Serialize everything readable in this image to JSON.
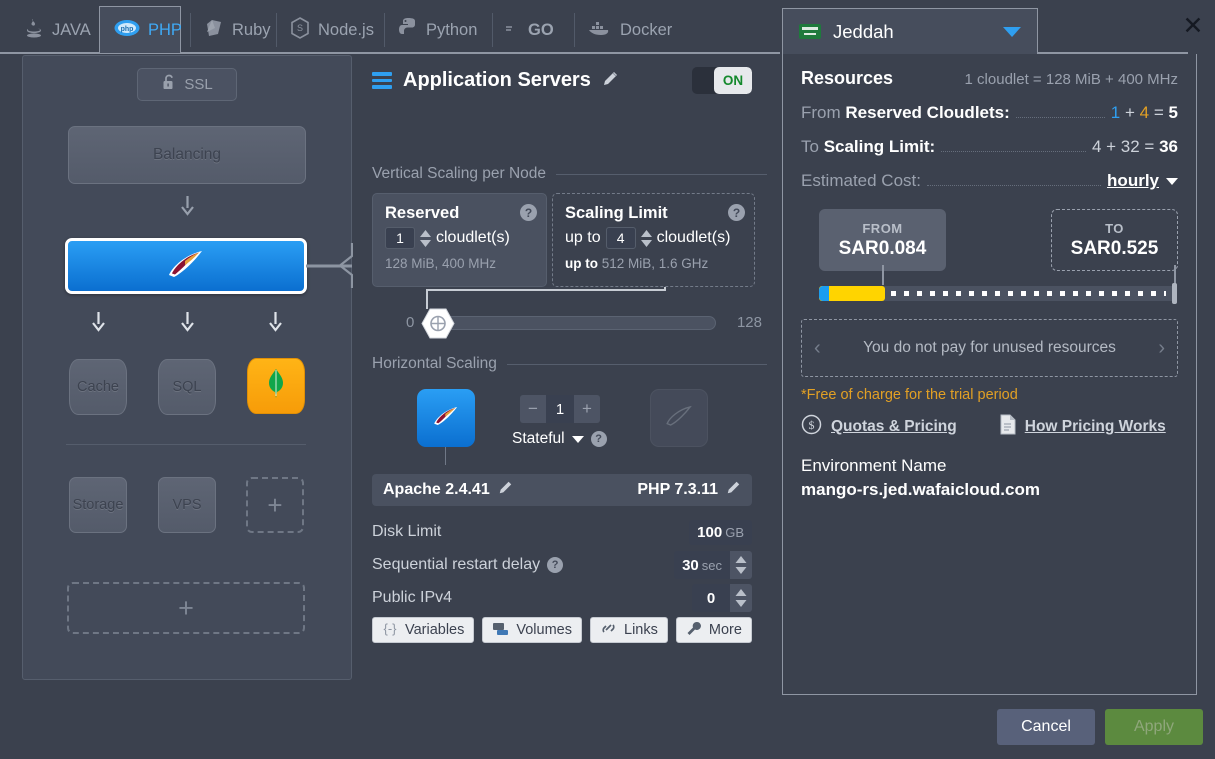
{
  "tabs": [
    {
      "id": "java",
      "label": "JAVA",
      "icon": "java-icon",
      "active": false
    },
    {
      "id": "php",
      "label": "PHP",
      "icon": "php-icon",
      "active": true
    },
    {
      "id": "ruby",
      "label": "Ruby",
      "icon": "ruby-icon",
      "active": false
    },
    {
      "id": "nodejs",
      "label": "Node.js",
      "icon": "nodejs-icon",
      "active": false
    },
    {
      "id": "python",
      "label": "Python",
      "icon": "python-icon",
      "active": false
    },
    {
      "id": "go",
      "label": "GO",
      "icon": "go-icon",
      "active": false
    },
    {
      "id": "docker",
      "label": "Docker",
      "icon": "docker-icon",
      "active": false
    }
  ],
  "topology": {
    "ssl_label": "SSL",
    "balancing_label": "Balancing",
    "selected_node_icon": "php-feather-icon",
    "tiles_row1": [
      {
        "label": "Cache",
        "kind": "text"
      },
      {
        "label": "SQL",
        "kind": "text"
      },
      {
        "label": "",
        "kind": "mongo"
      }
    ],
    "tiles_row2": [
      {
        "label": "Storage",
        "kind": "text"
      },
      {
        "label": "VPS",
        "kind": "text"
      },
      {
        "label": "+",
        "kind": "add"
      }
    ],
    "add_wide_label": "+"
  },
  "middle": {
    "title": "Application Servers",
    "toggle_label": "ON",
    "vertical_section": "Vertical Scaling per Node",
    "reserved": {
      "title": "Reserved",
      "value": "1",
      "unit": "cloudlet(s)",
      "sub": "128 MiB, 400 MHz",
      "help": "?"
    },
    "scaling_limit": {
      "title": "Scaling Limit",
      "prefix": "up to",
      "value": "4",
      "unit": "cloudlet(s)",
      "sub_prefix": "up to",
      "sub": "512 MiB, 1.6 GHz",
      "help": "?"
    },
    "slider": {
      "min": "0",
      "max": "128",
      "value": 1
    },
    "horizontal_section": "Horizontal Scaling",
    "node_count": "1",
    "minus": "−",
    "plus": "+",
    "stateful_label": "Stateful",
    "stateful_help": "?",
    "engine_left": "Apache 2.4.41",
    "engine_right": "PHP 7.3.11",
    "disk_limit": {
      "label": "Disk Limit",
      "value": "100",
      "unit": "GB"
    },
    "restart_delay": {
      "label": "Sequential restart delay",
      "help": "?",
      "value": "30",
      "unit": "sec"
    },
    "public_ipv4": {
      "label": "Public IPv4",
      "value": "0"
    },
    "buttons": [
      {
        "label": "Variables",
        "icon": "variables-icon"
      },
      {
        "label": "Volumes",
        "icon": "volumes-icon"
      },
      {
        "label": "Links",
        "icon": "links-icon"
      },
      {
        "label": "More",
        "icon": "wrench-icon"
      }
    ]
  },
  "right": {
    "region": "Jeddah",
    "region_flag": "saudi-arabia-flag-icon",
    "close": "✕",
    "resources_title": "Resources",
    "cloudlet_note": "1 cloudlet = 128 MiB + 400 MHz",
    "from_reserved": {
      "label_plain": "From ",
      "label_bold": "Reserved Cloudlets:",
      "a": "1",
      "op1": "+",
      "b": "4",
      "eq": "=",
      "total": "5"
    },
    "to_limit": {
      "label_plain": "To ",
      "label_bold": "Scaling Limit:",
      "expr": "4 + 32 = ",
      "total": "36"
    },
    "estimated_cost_label": "Estimated Cost:",
    "billing_period": "hourly",
    "price_from_cap": "FROM",
    "price_from": "SAR0.084",
    "price_to_cap": "TO",
    "price_to": "SAR0.525",
    "promo_text": "You do not pay for unused resources",
    "promo_prev": "‹",
    "promo_next": "›",
    "trial_note": "*Free of charge for the trial period",
    "link_quotas": "Quotas & Pricing",
    "link_pricing": "How Pricing Works",
    "env_name_label": "Environment Name",
    "env_name_value": "mango-rs.jed.wafaicloud.com"
  },
  "footer": {
    "cancel": "Cancel",
    "apply": "Apply"
  },
  "colors": {
    "accent_blue": "#2f9ff0",
    "bg": "#3b414e",
    "panel": "#434a59",
    "yellow": "#ffd400",
    "orange": "#e2a024",
    "green": "#5c8a3f"
  }
}
